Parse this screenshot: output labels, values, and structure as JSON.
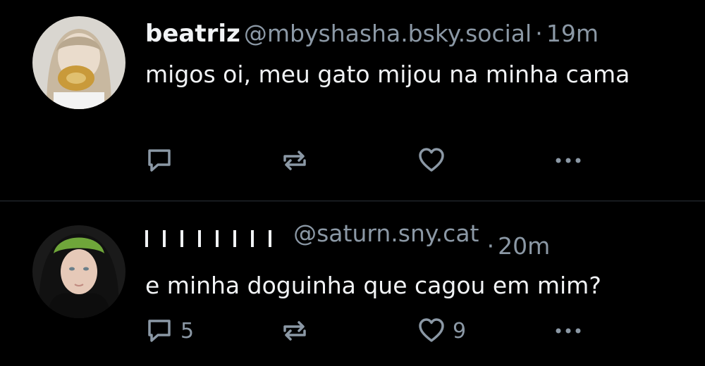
{
  "posts": [
    {
      "display_name": "beatriz",
      "handle": "@mbyshasha.bsky.social",
      "separator": "·",
      "time": "19m",
      "text": "migos oi, meu gato mijou na minha cama",
      "reply_count": "",
      "like_count": "",
      "icons": [
        "comment-icon",
        "repost-icon",
        "heart-icon",
        "more-icon"
      ]
    },
    {
      "display_name": "",
      "handle": "@saturn.sny.cat",
      "separator": "·",
      "time": "20m",
      "text": "e minha doguinha que cagou em mim?",
      "reply_count": "5",
      "like_count": "9",
      "icons": [
        "comment-icon",
        "repost-icon",
        "heart-icon",
        "more-icon"
      ]
    }
  ],
  "colors": {
    "background": "#000000",
    "text": "#f1f3f5",
    "muted": "#8b98a5",
    "divider": "#2b3139"
  }
}
